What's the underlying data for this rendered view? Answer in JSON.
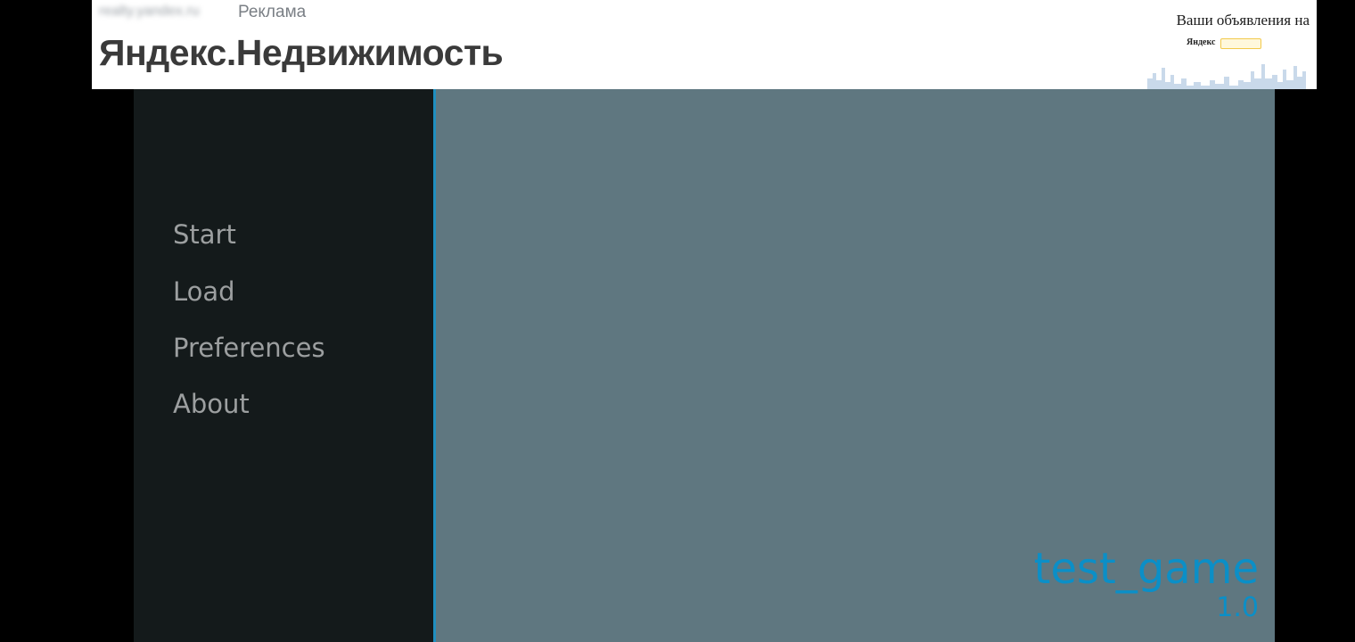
{
  "ad": {
    "domain": "realty.yandex.ru",
    "label": "Реклама",
    "title": "Яндекс.Недвижимость",
    "creative_text": "Ваши объявления на",
    "creative_logo": "Яндекс"
  },
  "game": {
    "menu": {
      "start": "Start",
      "load": "Load",
      "preferences": "Preferences",
      "about": "About"
    },
    "title": "test_game",
    "version": "1.0"
  },
  "colors": {
    "nav_background": "#141a1b",
    "main_background": "#5f7780",
    "accent": "#0b8fc7",
    "menu_text": "#9c9fa0"
  }
}
